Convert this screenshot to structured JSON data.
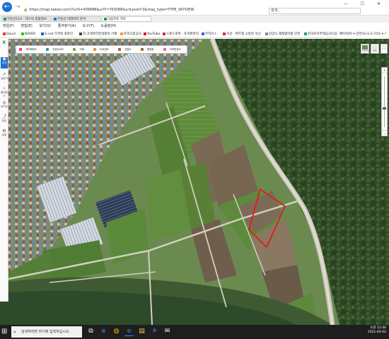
{
  "browser": {
    "url": "https://map.kakao.com/?urlX=409688&urlY=763088&urlLevel=3&map_type=TYPE_SKYVIEW",
    "search_placeholder": "검색...",
    "window_controls": "— ☐ ✕",
    "tabs": [
      {
        "label": "부동산114 - 대구의 종합정보",
        "color": "#2b9a3a",
        "active": false
      },
      {
        "label": "부동산 빅데이터 분석",
        "color": "#1a73e8",
        "active": false
      },
      {
        "label": "다음지도 지도",
        "color": "#2b9a3a",
        "active": true
      }
    ],
    "menu": [
      "파일(F)",
      "편집(E)",
      "보기(V)",
      "즐겨찾기(A)",
      "도구(T)",
      "도움말(H)"
    ],
    "favorites": [
      {
        "label": "Daum",
        "color": "#e33"
      },
      {
        "label": "NAVER",
        "color": "#1ec800"
      },
      {
        "label": "G-net 가격의 표준인",
        "color": "#06c"
      },
      {
        "label": "TJ 고객관리컨설판의 거제",
        "color": "#444"
      },
      {
        "label": "토목고층공사",
        "color": "#f90"
      },
      {
        "label": "YouTube",
        "color": "#e00"
      },
      {
        "label": "스톤드로톡 - 토목판관리",
        "color": "#c33"
      },
      {
        "label": "무자브스",
        "color": "#36c"
      },
      {
        "label": "옥션 - 파트별 소방된 옥선",
        "color": "#e22"
      },
      {
        "label": "당양시 재정법이를 인천",
        "color": "#888"
      },
      {
        "label": "한국토지주택공사도입정",
        "color": "#1a5"
      }
    ],
    "toolbar_right": [
      "페이지(P) ▾",
      "안전(S) ▾",
      "도구(O) ▾",
      "?"
    ]
  },
  "map": {
    "toolbar": [
      {
        "label": "세부행정도",
        "color": "#f36"
      },
      {
        "label": "산림도로도",
        "color": "#29a"
      },
      {
        "label": "지형",
        "color": "#6a3"
      },
      {
        "label": "도로경도",
        "color": "#e83"
      },
      {
        "label": "진찰도",
        "color": "#a55"
      },
      {
        "label": "행정동",
        "color": "#963"
      },
      {
        "label": "지적편집도",
        "color": "#c6c"
      }
    ],
    "left_panel": [
      {
        "label": "검색",
        "icon": "pin-icon",
        "glyph": "◉"
      },
      {
        "label": "길찾기",
        "icon": "route-icon",
        "glyph": "↗"
      },
      {
        "label": "즐겨찾기",
        "icon": "star-icon",
        "glyph": "☆"
      },
      {
        "label": "로드뷰",
        "icon": "roadview-icon",
        "glyph": "◎"
      },
      {
        "label": "공유",
        "icon": "share-icon",
        "glyph": "⤴"
      },
      {
        "label": "설정",
        "icon": "gear-icon",
        "glyph": "⚙"
      }
    ],
    "right_controls": [
      {
        "label": "스카이뷰"
      },
      {
        "label": "지도"
      }
    ],
    "zoom": {
      "plus": "+",
      "minus": "−"
    },
    "highlight_color": "#e21b1b"
  },
  "taskbar": {
    "search_placeholder": "검색하려면 여기에 입력하십시오.",
    "apps": [
      {
        "name": "task-view-icon",
        "glyph": "⧉",
        "color": "#fff"
      },
      {
        "name": "edge-icon",
        "glyph": "e",
        "color": "#3aa3ff"
      },
      {
        "name": "chrome-icon",
        "glyph": "◍",
        "color": "#f4b400"
      },
      {
        "name": "ie-icon",
        "glyph": "e",
        "color": "#1ba1e2"
      },
      {
        "name": "explorer-icon",
        "glyph": "▤",
        "color": "#f2c94c"
      },
      {
        "name": "hancom-icon",
        "glyph": "ㅎ",
        "color": "#3c8dde"
      },
      {
        "name": "mail-icon",
        "glyph": "✉",
        "color": "#fff"
      }
    ],
    "clock": "오후 12:40",
    "date": "2021-04-02"
  }
}
